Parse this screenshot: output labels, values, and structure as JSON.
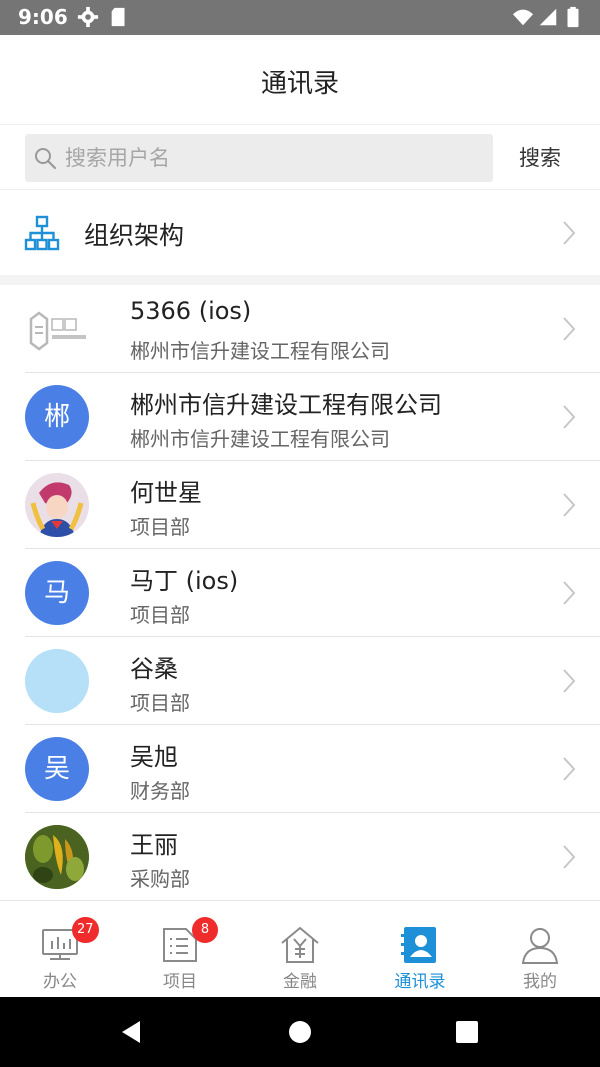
{
  "status_bar": {
    "time": "9:06"
  },
  "header": {
    "title": "通讯录"
  },
  "search": {
    "placeholder": "搜索用户名",
    "value": "",
    "button_label": "搜索"
  },
  "org": {
    "label": "组织架构"
  },
  "contacts": [
    {
      "name": "5366 (ios)",
      "department": "郴州市信升建设工程有限公司",
      "avatar_text": "",
      "avatar_type": "logo",
      "avatar_color": "#ffffff"
    },
    {
      "name": "郴州市信升建设工程有限公司",
      "department": "郴州市信升建设工程有限公司",
      "avatar_text": "郴",
      "avatar_type": "initial",
      "avatar_color": "#4a7fe6"
    },
    {
      "name": "何世星",
      "department": "项目部",
      "avatar_text": "",
      "avatar_type": "photo-cartoon",
      "avatar_color": "#f3c7c8"
    },
    {
      "name": "马丁 (ios)",
      "department": "项目部",
      "avatar_text": "马",
      "avatar_type": "initial",
      "avatar_color": "#4a7fe6"
    },
    {
      "name": "谷桑",
      "department": "项目部",
      "avatar_text": "",
      "avatar_type": "blank",
      "avatar_color": "#b5e0f7"
    },
    {
      "name": "吴旭",
      "department": "财务部",
      "avatar_text": "吴",
      "avatar_type": "initial",
      "avatar_color": "#4a7fe6"
    },
    {
      "name": "王丽",
      "department": "采购部",
      "avatar_text": "",
      "avatar_type": "photo-fruit",
      "avatar_color": "#5c7a2a"
    }
  ],
  "tabs": [
    {
      "label": "办公",
      "icon": "office-icon",
      "badge": "27",
      "active": false
    },
    {
      "label": "项目",
      "icon": "project-icon",
      "badge": "8",
      "active": false
    },
    {
      "label": "金融",
      "icon": "finance-icon",
      "badge": "",
      "active": false
    },
    {
      "label": "通讯录",
      "icon": "contacts-icon",
      "badge": "",
      "active": true
    },
    {
      "label": "我的",
      "icon": "profile-icon",
      "badge": "",
      "active": false
    }
  ],
  "colors": {
    "accent": "#1e90d8",
    "avatar_blue": "#4a7fe6",
    "badge": "#f02b2b",
    "status_bar": "#757575"
  }
}
